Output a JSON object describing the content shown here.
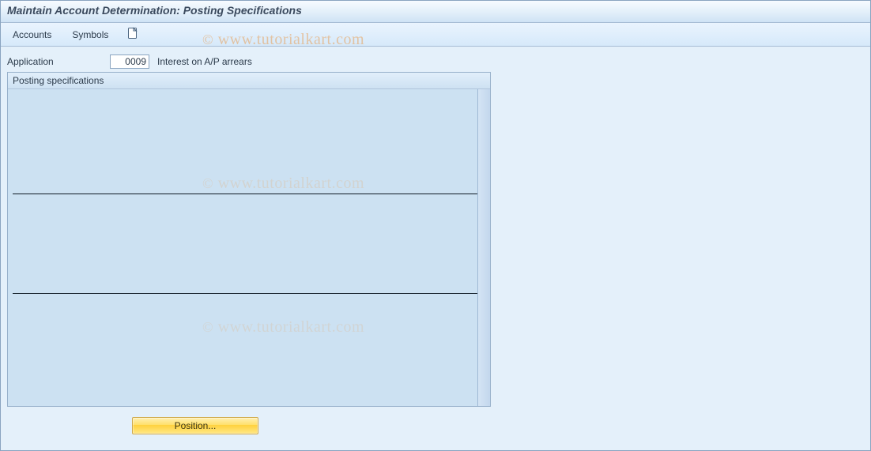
{
  "header": {
    "title": "Maintain Account Determination: Posting Specifications"
  },
  "toolbar": {
    "accounts_label": "Accounts",
    "symbols_label": "Symbols",
    "create_icon": "create-icon"
  },
  "field": {
    "application_label": "Application",
    "application_value": "0009",
    "application_description": "Interest on A/P arrears"
  },
  "group": {
    "title": "Posting specifications"
  },
  "buttons": {
    "position_label": "Position..."
  },
  "watermark": {
    "text": "© www.tutorialkart.com"
  }
}
